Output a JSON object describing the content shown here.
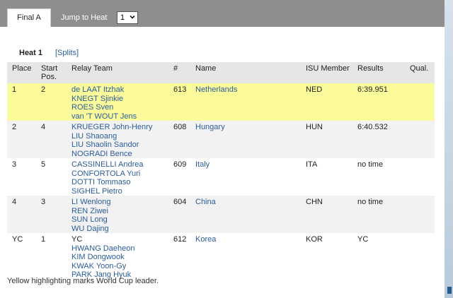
{
  "tabs": {
    "active_label": "Final A",
    "jump_label": "Jump to Heat",
    "heat_selected": "1"
  },
  "heat": {
    "title": "Heat 1",
    "splits_label": "[Splits]"
  },
  "columns": [
    "Place",
    "Start Pos.",
    "Relay Team",
    "#",
    "Name",
    "ISU Member",
    "Results",
    "Qual."
  ],
  "rows": [
    {
      "place": "1",
      "start": "2",
      "team": [
        "de LAAT Itzhak",
        "KNEGT Sjinkie",
        "ROES Sven",
        "van 'T WOUT Jens"
      ],
      "num": "613",
      "name": "Netherlands",
      "member": "NED",
      "result": "6:39.951",
      "qual": ""
    },
    {
      "place": "2",
      "start": "4",
      "team": [
        "KRUEGER John-Henry",
        "LIU Shaoang",
        "LIU Shaolin Sandor",
        "NOGRADI Bence"
      ],
      "num": "608",
      "name": "Hungary",
      "member": "HUN",
      "result": "6:40.532",
      "qual": ""
    },
    {
      "place": "3",
      "start": "5",
      "team": [
        "CASSINELLI Andrea",
        "CONFORTOLA Yuri",
        "DOTTI Tommaso",
        "SIGHEL Pietro"
      ],
      "num": "609",
      "name": "Italy",
      "member": "ITA",
      "result": "no time",
      "qual": ""
    },
    {
      "place": "4",
      "start": "3",
      "team": [
        "LI Wenlong",
        "REN Ziwei",
        "SUN Long",
        "WU Dajing"
      ],
      "num": "604",
      "name": "China",
      "member": "CHN",
      "result": "no time",
      "qual": ""
    },
    {
      "place": "YC",
      "start": "1",
      "team_status": "YC",
      "team": [
        "HWANG Daeheon",
        "KIM Dongwook",
        "KWAK Yoon-Gy",
        "PARK Jang Hyuk"
      ],
      "num": "612",
      "name": "Korea",
      "member": "KOR",
      "result": "YC",
      "qual": ""
    }
  ],
  "footnote": "Yellow highlighting marks World Cup leader.",
  "colors": {
    "leader_highlight": "#fbfb9b",
    "link": "#2a5c9a",
    "tabbar": "#8e8e8e"
  }
}
